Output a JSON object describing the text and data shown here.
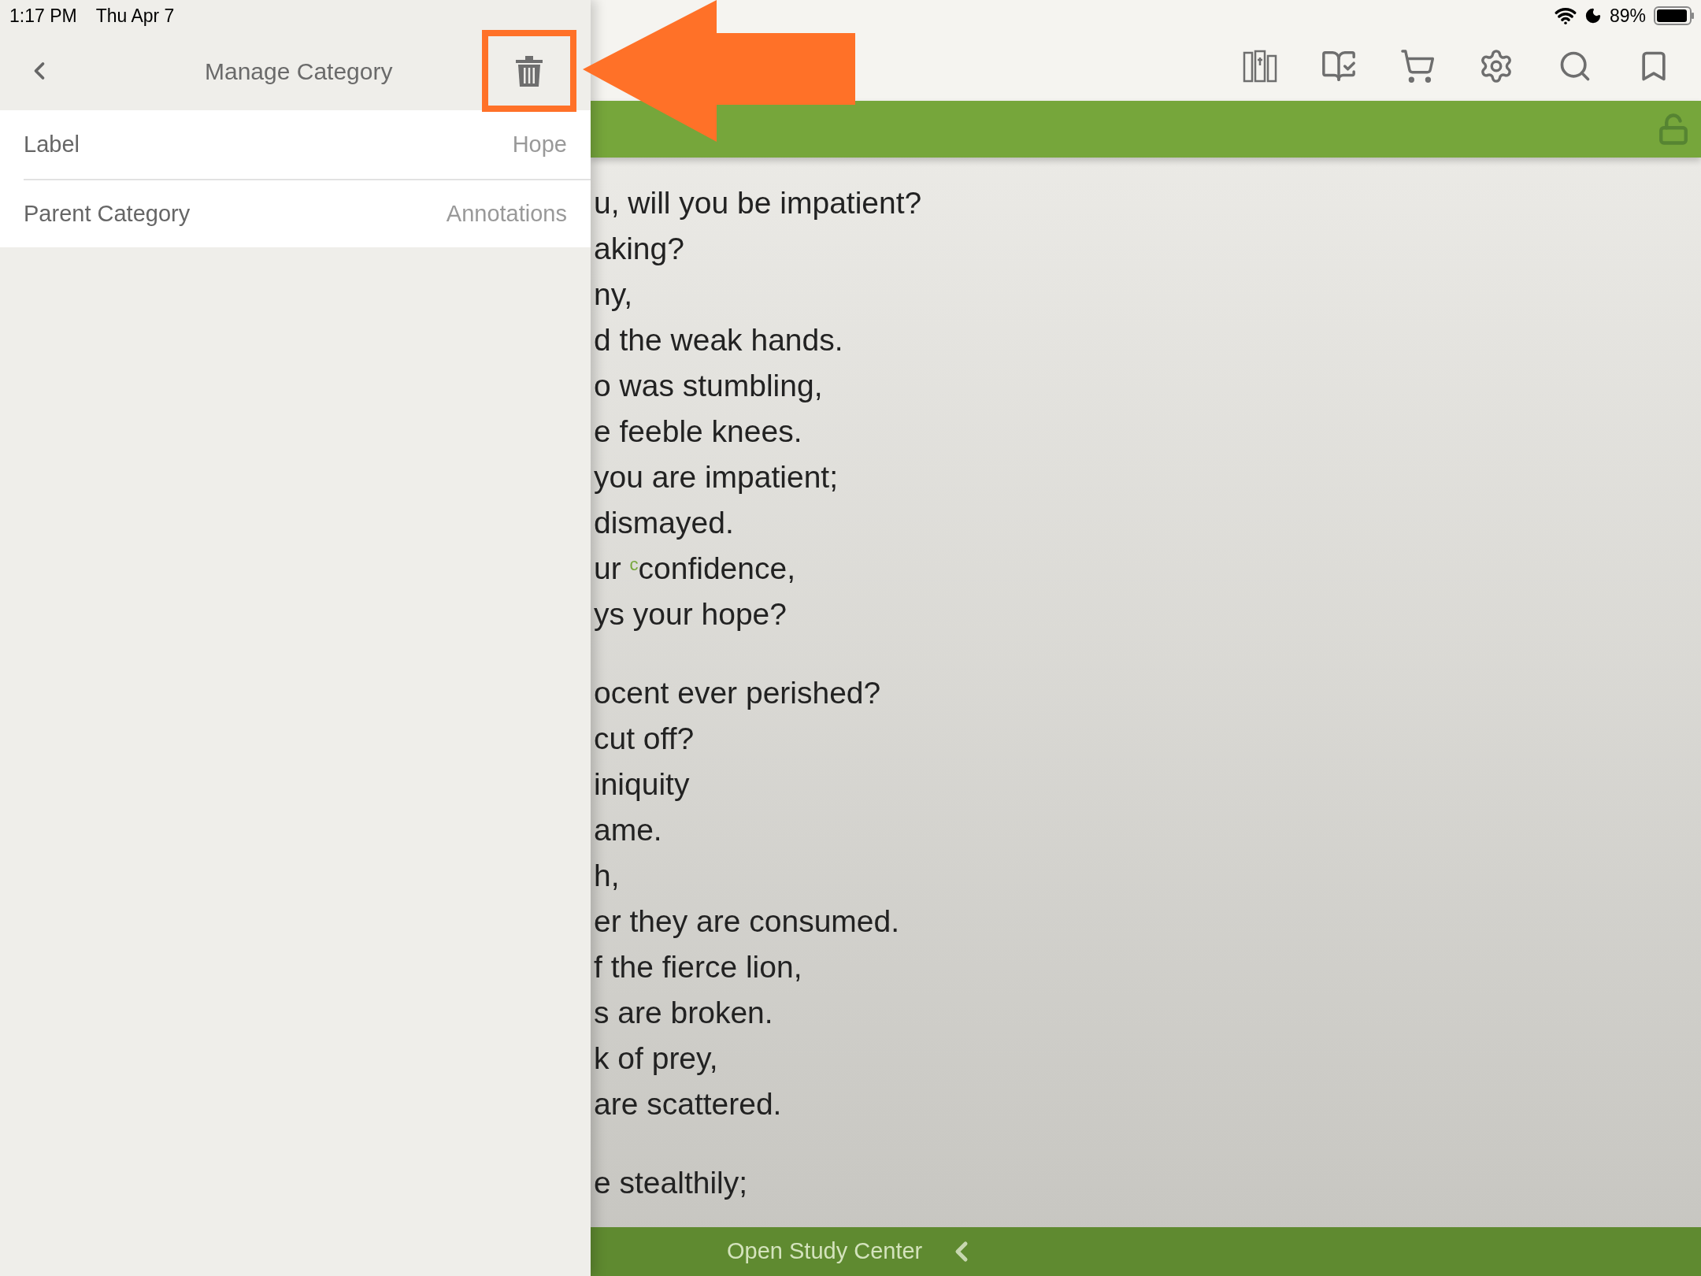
{
  "status_bar": {
    "time": "1:17 PM",
    "date": "Thu Apr 7",
    "battery": "89%"
  },
  "panel": {
    "title": "Manage Category",
    "rows": [
      {
        "label": "Label",
        "value": "Hope"
      },
      {
        "label": "Parent Category",
        "value": "Annotations"
      }
    ]
  },
  "reader": {
    "stanzas": [
      [
        "u, will you be impatient?",
        "aking?",
        "ny,",
        "d the weak hands.",
        "o was stumbling,",
        "e feeble knees.",
        "you are impatient;",
        "dismayed.",
        "ur $^{c}$confidence,",
        "ys your hope?"
      ],
      [
        "ocent ever perished?",
        "cut off?",
        "iniquity",
        "ame.",
        "h,",
        "er they are consumed.",
        "f the fierce lion,",
        "s are broken.",
        "k of prey,",
        "are scattered."
      ],
      [
        "e stealthily;"
      ]
    ]
  },
  "bottom_bar": {
    "label": "Open Study Center"
  }
}
